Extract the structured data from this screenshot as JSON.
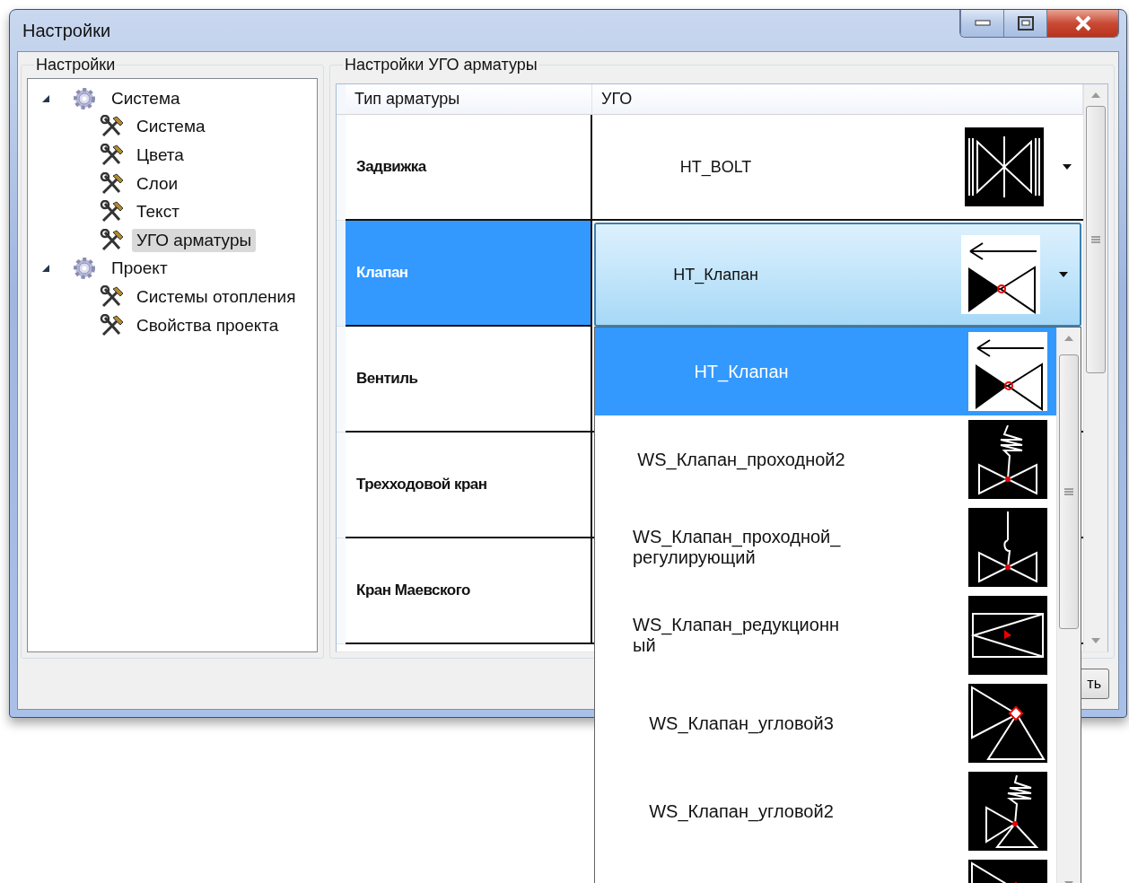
{
  "window": {
    "title": "Настройки"
  },
  "settings_group": {
    "title": "Настройки"
  },
  "tree": [
    {
      "label": "Система",
      "expanded": true,
      "selected": false,
      "children": [
        {
          "label": "Система",
          "selected": false
        },
        {
          "label": "Цвета",
          "selected": false
        },
        {
          "label": "Слои",
          "selected": false
        },
        {
          "label": "Текст",
          "selected": false
        },
        {
          "label": "УГО арматуры",
          "selected": true
        }
      ]
    },
    {
      "label": "Проект",
      "expanded": true,
      "selected": false,
      "children": [
        {
          "label": "Системы отопления",
          "selected": false
        },
        {
          "label": "Свойства проекта",
          "selected": false
        }
      ]
    }
  ],
  "ugo_group": {
    "title": "Настройки УГО арматуры"
  },
  "table": {
    "columns": [
      "Тип арматуры",
      "УГО"
    ],
    "rows": [
      {
        "type": "Задвижка",
        "selected": false,
        "open": false,
        "ugo": {
          "value": "HT_BOLT",
          "kind": "bolt"
        }
      },
      {
        "type": "Клапан",
        "selected": true,
        "open": true,
        "ugo": {
          "value": "HT_Клапан",
          "kind": "check"
        }
      },
      {
        "type": "Вентиль",
        "selected": false,
        "open": false
      },
      {
        "type": "Трехходовой кран",
        "selected": false,
        "open": false
      },
      {
        "type": "Кран Маевского",
        "selected": false,
        "open": false
      }
    ]
  },
  "dropdown": {
    "items": [
      {
        "name": "HT_Клапан",
        "kind": "check",
        "selected": true
      },
      {
        "name": "WS_Клапан_проходной2",
        "kind": "spring",
        "selected": false
      },
      {
        "name": "WS_Клапан_проходной_регулирующий",
        "kind": "stem",
        "selected": false
      },
      {
        "name": "WS_Клапан_редукционный",
        "kind": "reducing",
        "selected": false
      },
      {
        "name": "WS_Клапан_угловой3",
        "kind": "angle",
        "selected": false
      },
      {
        "name": "WS_Клапан_угловой2",
        "kind": "anglespring",
        "selected": false
      },
      {
        "kind": "angle",
        "selected": false
      }
    ]
  },
  "footer_button": "ть"
}
